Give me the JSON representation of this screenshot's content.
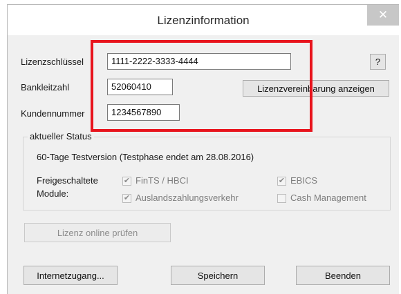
{
  "window": {
    "title": "Lizenzinformation",
    "close_glyph": "✕"
  },
  "license": {
    "key_label": "Lizenzschlüssel",
    "key_value": "1111-2222-3333-4444",
    "help_label": "?",
    "blz_label": "Bankleitzahl",
    "blz_value": "52060410",
    "agreement_button": "Lizenzvereinbarung anzeigen",
    "customer_label": "Kundennummer",
    "customer_value": "1234567890"
  },
  "status": {
    "group_title": "aktueller Status",
    "text": "60-Tage Testversion (Testphase endet am 28.08.2016)",
    "modules_label_line1": "Freigeschaltete",
    "modules_label_line2": "Module:",
    "modules": [
      {
        "label": "FinTS / HBCI",
        "checked": true
      },
      {
        "label": "EBICS",
        "checked": true
      },
      {
        "label": "Auslandszahlungsverkehr",
        "checked": true
      },
      {
        "label": "Cash Management",
        "checked": false
      }
    ],
    "online_check_button": "Lizenz online prüfen"
  },
  "footer": {
    "internet_button": "Internetzugang...",
    "save_button": "Speichern",
    "exit_button": "Beenden"
  },
  "colors": {
    "highlight": "#e8141d",
    "close_button_bg": "#c7c7c7"
  }
}
